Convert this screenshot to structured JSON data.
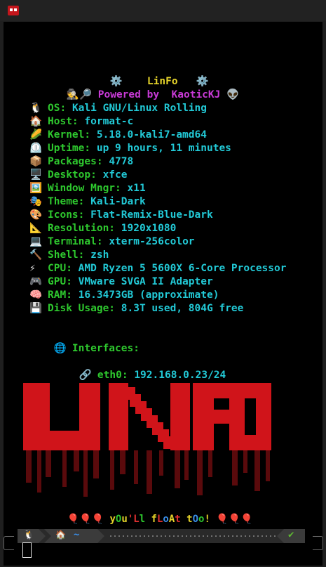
{
  "window": {
    "app_icon": "terminal-app-icon"
  },
  "header": {
    "title_left_icon": "⚙️",
    "title": "LinFo",
    "title_right_icon": "⚙️",
    "powered_icon": "🕵🔎",
    "powered_text": "Powered by  KaoticKJ",
    "powered_end_icon": "👽"
  },
  "info": [
    {
      "icon": "🐧",
      "label": "OS:",
      "value": "Kali GNU/Linux Rolling"
    },
    {
      "icon": "🏠",
      "label": "Host:",
      "value": "format-c"
    },
    {
      "icon": "🌽",
      "label": "Kernel:",
      "value": "5.18.0-kali7-amd64"
    },
    {
      "icon": "⏲️",
      "label": "Uptime:",
      "value": "up 9 hours, 11 minutes"
    },
    {
      "icon": "📦",
      "label": "Packages:",
      "value": "4778"
    },
    {
      "icon": "🖥️",
      "label": "Desktop:",
      "value": "xfce"
    },
    {
      "icon": "🖼️",
      "label": "Window Mngr:",
      "value": "x11"
    },
    {
      "icon": "🎭",
      "label": "Theme:",
      "value": "Kali-Dark"
    },
    {
      "icon": "🎨",
      "label": "Icons:",
      "value": "Flat-Remix-Blue-Dark"
    },
    {
      "icon": "📐",
      "label": "Resolution:",
      "value": "1920x1080"
    },
    {
      "icon": "💻",
      "label": "Terminal:",
      "value": "xterm-256color"
    },
    {
      "icon": "🔨",
      "label": "Shell:",
      "value": "zsh"
    },
    {
      "icon": "⚡",
      "label": "CPU:",
      "value": "AMD Ryzen 5 5600X 6-Core Processor"
    },
    {
      "icon": "🎮",
      "label": "GPU:",
      "value": "VMware SVGA II Adapter"
    },
    {
      "icon": "🧠",
      "label": "RAM:",
      "value": "16.3473GB (approximate)"
    },
    {
      "icon": "💾",
      "label": "Disk Usage:",
      "value": "8.3T used, 804G free"
    }
  ],
  "interfaces": {
    "icon": "🌐",
    "label": "Interfaces:",
    "items": [
      {
        "icon": "🔗",
        "name": "eth0:",
        "address": "192.168.0.23/24"
      }
    ]
  },
  "banner": {
    "text": "LINFO",
    "color": "#d0141a",
    "shadow_color": "#5a0a0c"
  },
  "float_line": {
    "left_balloons": "🎈🎈🎈",
    "right_balloons": "🎈🎈🎈",
    "chars": [
      {
        "ch": "y",
        "color": "#e5d32a"
      },
      {
        "ch": "O",
        "color": "#2ec82e"
      },
      {
        "ch": "u",
        "color": "#e5d32a"
      },
      {
        "ch": "'",
        "color": "#e03030"
      },
      {
        "ch": "L",
        "color": "#e03030"
      },
      {
        "ch": "l",
        "color": "#2ec82e"
      },
      {
        "ch": " ",
        "color": "#ffffff"
      },
      {
        "ch": "f",
        "color": "#e5d32a"
      },
      {
        "ch": "L",
        "color": "#e03030"
      },
      {
        "ch": "o",
        "color": "#3a8ee8"
      },
      {
        "ch": "A",
        "color": "#e5d32a"
      },
      {
        "ch": "t",
        "color": "#e03030"
      },
      {
        "ch": " ",
        "color": "#ffffff"
      },
      {
        "ch": "t",
        "color": "#e5d32a"
      },
      {
        "ch": "O",
        "color": "#3a8ee8"
      },
      {
        "ch": "o",
        "color": "#2ec82e"
      },
      {
        "ch": "!",
        "color": "#e5d32a"
      }
    ]
  },
  "prompt": {
    "os_icon": "🐧",
    "home_icon": "🏠",
    "path": "~",
    "status_icon": "✔",
    "status_color": "#5fb832"
  },
  "colors": {
    "label": "#2ec82e",
    "value": "#22c9d6",
    "title": "#e5d32a",
    "powered": "#c83ad6"
  }
}
